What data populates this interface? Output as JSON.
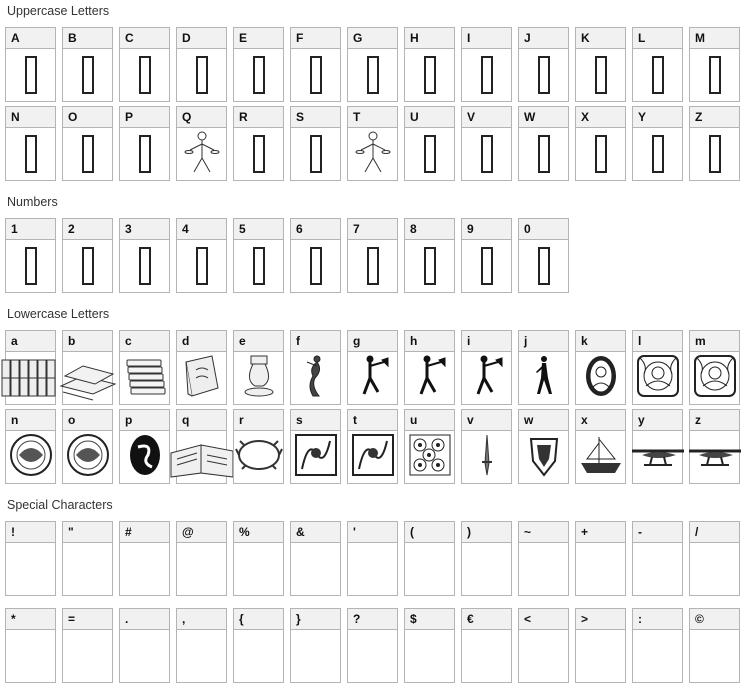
{
  "sections": {
    "uppercase": "Uppercase Letters",
    "numbers": "Numbers",
    "lowercase": "Lowercase Letters",
    "special": "Special Characters"
  },
  "uppercase_rows": [
    [
      "A",
      "B",
      "C",
      "D",
      "E",
      "F",
      "G",
      "H",
      "I",
      "J",
      "K",
      "L",
      "M"
    ],
    [
      "N",
      "O",
      "P",
      "Q",
      "R",
      "S",
      "T",
      "U",
      "V",
      "W",
      "X",
      "Y",
      "Z"
    ]
  ],
  "numbers_row": [
    "1",
    "2",
    "3",
    "4",
    "5",
    "6",
    "7",
    "8",
    "9",
    "0"
  ],
  "lowercase_rows": [
    [
      "a",
      "b",
      "c",
      "d",
      "e",
      "f",
      "g",
      "h",
      "i",
      "j",
      "k",
      "l",
      "m"
    ],
    [
      "n",
      "o",
      "p",
      "q",
      "r",
      "s",
      "t",
      "u",
      "v",
      "w",
      "x",
      "y",
      "z"
    ]
  ],
  "special_rows": [
    [
      "!",
      "\"",
      "#",
      "@",
      "%",
      "&",
      "'",
      "(",
      ")",
      "~",
      "+",
      "-",
      "/"
    ],
    [
      "*",
      "=",
      ".",
      ",",
      "{",
      "}",
      "?",
      "$",
      "€",
      "<",
      ">",
      ":",
      "©"
    ]
  ],
  "glyph_types": {
    "Q": "waiter-icon",
    "T": "waiter-icon",
    "a": "books-row-icon",
    "b": "stacked-books-icon",
    "c": "book-pile-icon",
    "d": "open-book-icon",
    "e": "vase-icon",
    "f": "dancer-icon",
    "g": "trumpeter-icon",
    "h": "trumpeter-icon",
    "i": "trumpeter-icon",
    "j": "silhouette-figure-icon",
    "k": "oval-portrait-icon",
    "l": "ornate-portrait-icon",
    "m": "ornate-portrait-icon",
    "n": "circular-emblem-icon",
    "o": "circular-emblem-icon",
    "p": "oval-emblem-icon",
    "q": "open-book-wide-icon",
    "r": "wreath-icon",
    "s": "square-ornament-icon",
    "t": "square-ornament-icon",
    "u": "floral-square-icon",
    "v": "dagger-icon",
    "w": "shield-icon",
    "x": "ship-icon",
    "y": "seaplane-icon",
    "z": "seaplane-icon"
  }
}
